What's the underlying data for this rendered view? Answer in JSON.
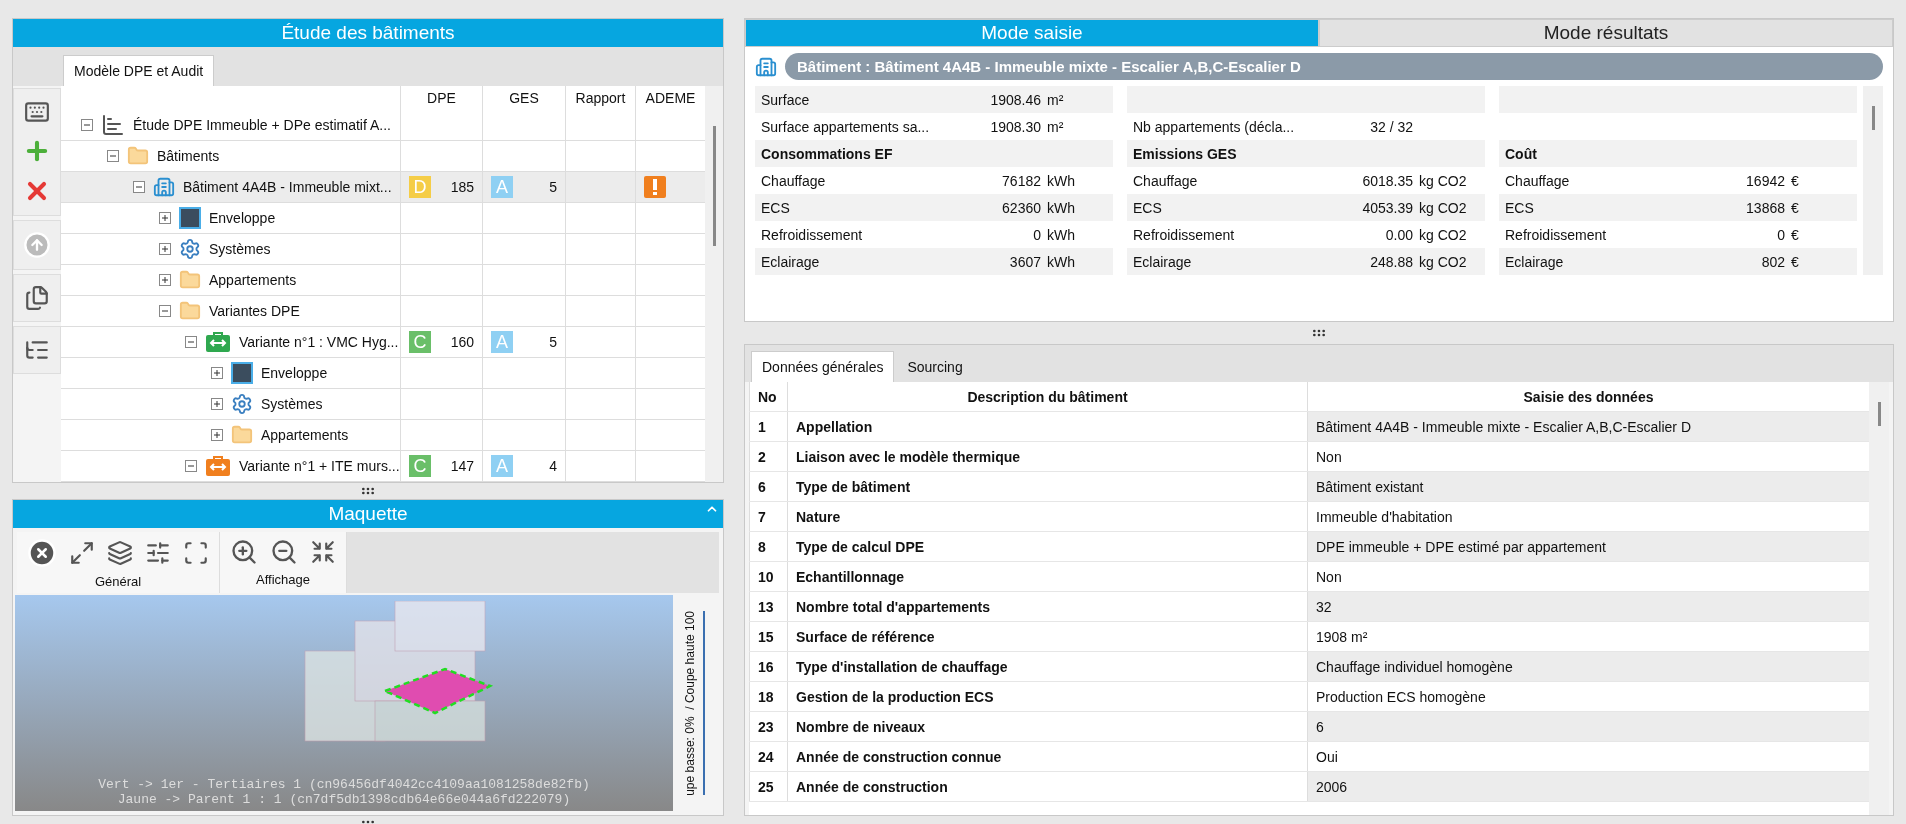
{
  "study_panel": {
    "title": "Étude des bâtiments",
    "tabs": [
      {
        "label": "Modèle DPE et Audit",
        "selected": true
      }
    ],
    "tree": {
      "columns": [
        "DPE",
        "GES",
        "Rapport",
        "ADEME"
      ],
      "nodes": [
        {
          "label": "Étude DPE Immeuble + DPe estimatif A...",
          "kind": "study",
          "expanded": true,
          "selected": false,
          "children": [
            {
              "label": "Bâtiments",
              "kind": "folder",
              "expanded": true,
              "selected": false,
              "children": [
                {
                  "label": "Bâtiment 4A4B - Immeuble mixt...",
                  "kind": "building",
                  "expanded": true,
                  "selected": true,
                  "dpe": {
                    "grade": "D",
                    "color": "#f5cd47",
                    "value": "185"
                  },
                  "ges": {
                    "grade": "A",
                    "color": "#8fd0f3",
                    "value": "5"
                  },
                  "alert": true,
                  "children": [
                    {
                      "label": "Enveloppe",
                      "kind": "envelope",
                      "expanded": false,
                      "selected": false
                    },
                    {
                      "label": "Systèmes",
                      "kind": "systems",
                      "expanded": false,
                      "selected": false
                    },
                    {
                      "label": "Appartements",
                      "kind": "folder",
                      "expanded": false,
                      "selected": false
                    },
                    {
                      "label": "Variantes DPE",
                      "kind": "folder",
                      "expanded": true,
                      "selected": false,
                      "children": [
                        {
                          "label": "Variante n°1 : VMC Hyg...",
                          "kind": "variant",
                          "color": "#2fa84f",
                          "expanded": true,
                          "selected": false,
                          "dpe": {
                            "grade": "C",
                            "color": "#6abf69",
                            "value": "160"
                          },
                          "ges": {
                            "grade": "A",
                            "color": "#8fd0f3",
                            "value": "5"
                          },
                          "alert": false,
                          "children": [
                            {
                              "label": "Enveloppe",
                              "kind": "envelope",
                              "expanded": false,
                              "selected": false
                            },
                            {
                              "label": "Systèmes",
                              "kind": "systems",
                              "expanded": false,
                              "selected": false
                            },
                            {
                              "label": "Appartements",
                              "kind": "folder",
                              "expanded": false,
                              "selected": false
                            }
                          ]
                        },
                        {
                          "label": "Variante n°1 + ITE murs...",
                          "kind": "variant",
                          "color": "#f07f1e",
                          "expanded": true,
                          "selected": false,
                          "dpe": {
                            "grade": "C",
                            "color": "#6abf69",
                            "value": "147"
                          },
                          "ges": {
                            "grade": "A",
                            "color": "#8fd0f3",
                            "value": "4"
                          },
                          "alert": false
                        }
                      ]
                    }
                  ]
                }
              ]
            }
          ]
        }
      ]
    }
  },
  "model_panel": {
    "title": "Maquette",
    "toolbar_groups": [
      {
        "label": "Général"
      },
      {
        "label": "Affichage"
      }
    ],
    "overlay_lines": [
      "Vert -> 1er - Tertiaires 1 (cn96456df4042cc4109aa1081258de82fb)",
      "Jaune -> Parent 1 : 1 (cn7df5db1398cdb64e66e044a6fd222079)"
    ],
    "cut_slider": {
      "label": "upe basse: 0%  / Coupe haute 100",
      "level": 1
    }
  },
  "mode_tabs": [
    {
      "label": "Mode saisie",
      "selected": true
    },
    {
      "label": "Mode résultats",
      "selected": false
    }
  ],
  "building_header": "Bâtiment : Bâtiment 4A4B - Immeuble mixte - Escalier A,B,C-Escalier D",
  "summary_rows": [
    [
      {
        "kind": "item",
        "label": "Surface",
        "value": "1908.46",
        "unit": "m²"
      },
      null,
      null
    ],
    [
      {
        "kind": "item",
        "label": "Surface appartements sa...",
        "value": "1908.30",
        "unit": "m²"
      },
      {
        "kind": "item",
        "label": "Nb appartements (décla...",
        "value": "32 / 32"
      },
      null
    ],
    [
      {
        "kind": "heading",
        "label": "Consommations EF"
      },
      {
        "kind": "heading",
        "label": "Emissions GES"
      },
      {
        "kind": "heading",
        "label": "Coût"
      }
    ],
    [
      {
        "kind": "item",
        "label": "Chauffage",
        "value": "76182",
        "unit": "kWh"
      },
      {
        "kind": "item",
        "label": "Chauffage",
        "value": "6018.35",
        "unit": "kg CO2"
      },
      {
        "kind": "item",
        "label": "Chauffage",
        "value": "16942",
        "unit": "€"
      }
    ],
    [
      {
        "kind": "item",
        "label": "ECS",
        "value": "62360",
        "unit": "kWh"
      },
      {
        "kind": "item",
        "label": "ECS",
        "value": "4053.39",
        "unit": "kg CO2"
      },
      {
        "kind": "item",
        "label": "ECS",
        "value": "13868",
        "unit": "€"
      }
    ],
    [
      {
        "kind": "item",
        "label": "Refroidissement",
        "value": "0",
        "unit": "kWh"
      },
      {
        "kind": "item",
        "label": "Refroidissement",
        "value": "0.00",
        "unit": "kg CO2"
      },
      {
        "kind": "item",
        "label": "Refroidissement",
        "value": "0",
        "unit": "€"
      }
    ],
    [
      {
        "kind": "item",
        "label": "Eclairage",
        "value": "3607",
        "unit": "kWh"
      },
      {
        "kind": "item",
        "label": "Eclairage",
        "value": "248.88",
        "unit": "kg CO2"
      },
      {
        "kind": "item",
        "label": "Eclairage",
        "value": "802",
        "unit": "€"
      }
    ]
  ],
  "data_tabs": [
    {
      "label": "Données générales",
      "selected": true
    },
    {
      "label": "Sourcing",
      "selected": false
    }
  ],
  "data_table": {
    "columns": [
      "No",
      "Description du bâtiment",
      "Saisie des données"
    ],
    "rows": [
      [
        "1",
        "Appellation",
        "Bâtiment 4A4B - Immeuble mixte - Escalier A,B,C-Escalier D"
      ],
      [
        "2",
        "Liaison avec le modèle thermique",
        "Non"
      ],
      [
        "6",
        "Type de bâtiment",
        "Bâtiment existant"
      ],
      [
        "7",
        "Nature",
        "Immeuble d'habitation"
      ],
      [
        "8",
        "Type de calcul DPE",
        "DPE immeuble + DPE estimé par appartement"
      ],
      [
        "10",
        "Echantillonnage",
        "Non"
      ],
      [
        "13",
        "Nombre total d'appartements",
        "32"
      ],
      [
        "15",
        "Surface de référence",
        "1908 m²"
      ],
      [
        "16",
        "Type d'installation de chauffage",
        "Chauffage individuel homogène"
      ],
      [
        "18",
        "Gestion de la production ECS",
        "Production ECS homogène"
      ],
      [
        "23",
        "Nombre de niveaux",
        "6"
      ],
      [
        "24",
        "Année de construction connue",
        "Oui"
      ],
      [
        "25",
        "Année de construction",
        "2006"
      ]
    ]
  }
}
